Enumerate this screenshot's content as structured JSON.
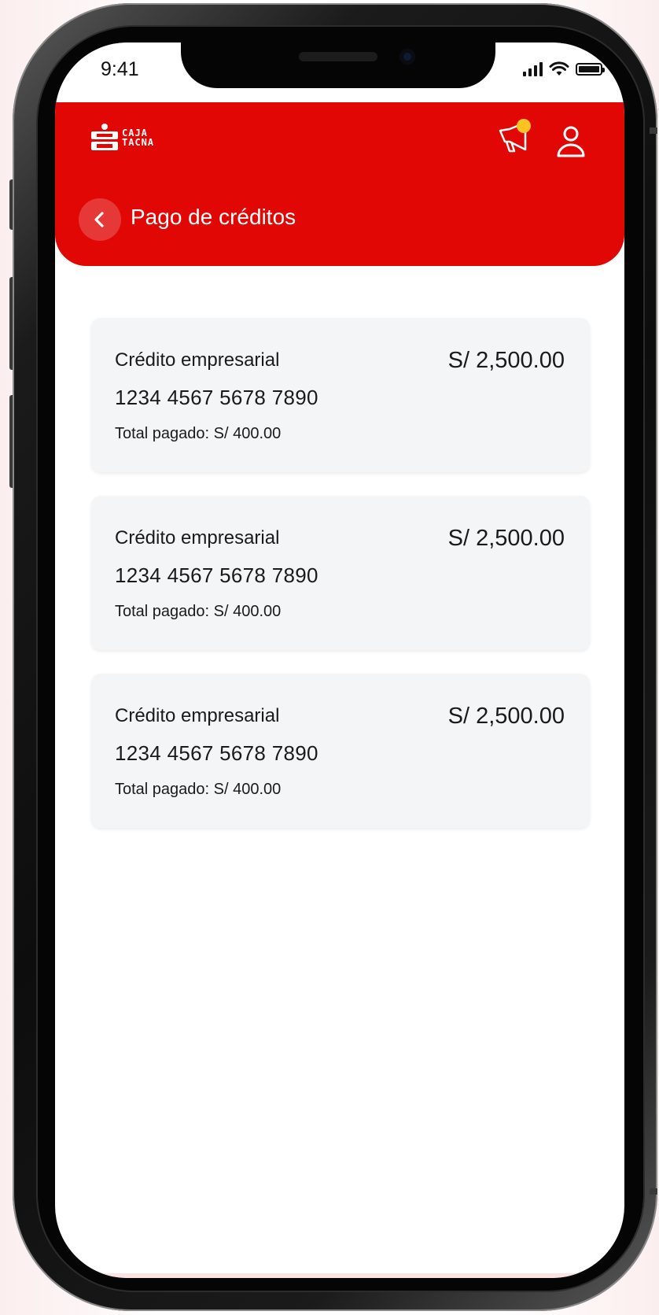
{
  "status_bar": {
    "time": "9:41"
  },
  "header": {
    "logo_line1": "CAJA",
    "logo_line2": "TACNA",
    "page_title": "Pago de créditos",
    "brand_color": "#e00705",
    "notification_color": "#f9c323"
  },
  "credits": [
    {
      "name": "Crédito empresarial",
      "amount": "S/ 2,500.00",
      "number": "1234 4567 5678 7890",
      "paid": "Total pagado: S/ 400.00"
    },
    {
      "name": "Crédito empresarial",
      "amount": "S/ 2,500.00",
      "number": "1234 4567 5678 7890",
      "paid": "Total pagado: S/ 400.00"
    },
    {
      "name": "Crédito empresarial",
      "amount": "S/ 2,500.00",
      "number": "1234 4567 5678 7890",
      "paid": "Total pagado: S/ 400.00"
    }
  ],
  "icons": {
    "back": "chevron-left-icon",
    "promo": "megaphone-icon",
    "user": "user-icon"
  }
}
